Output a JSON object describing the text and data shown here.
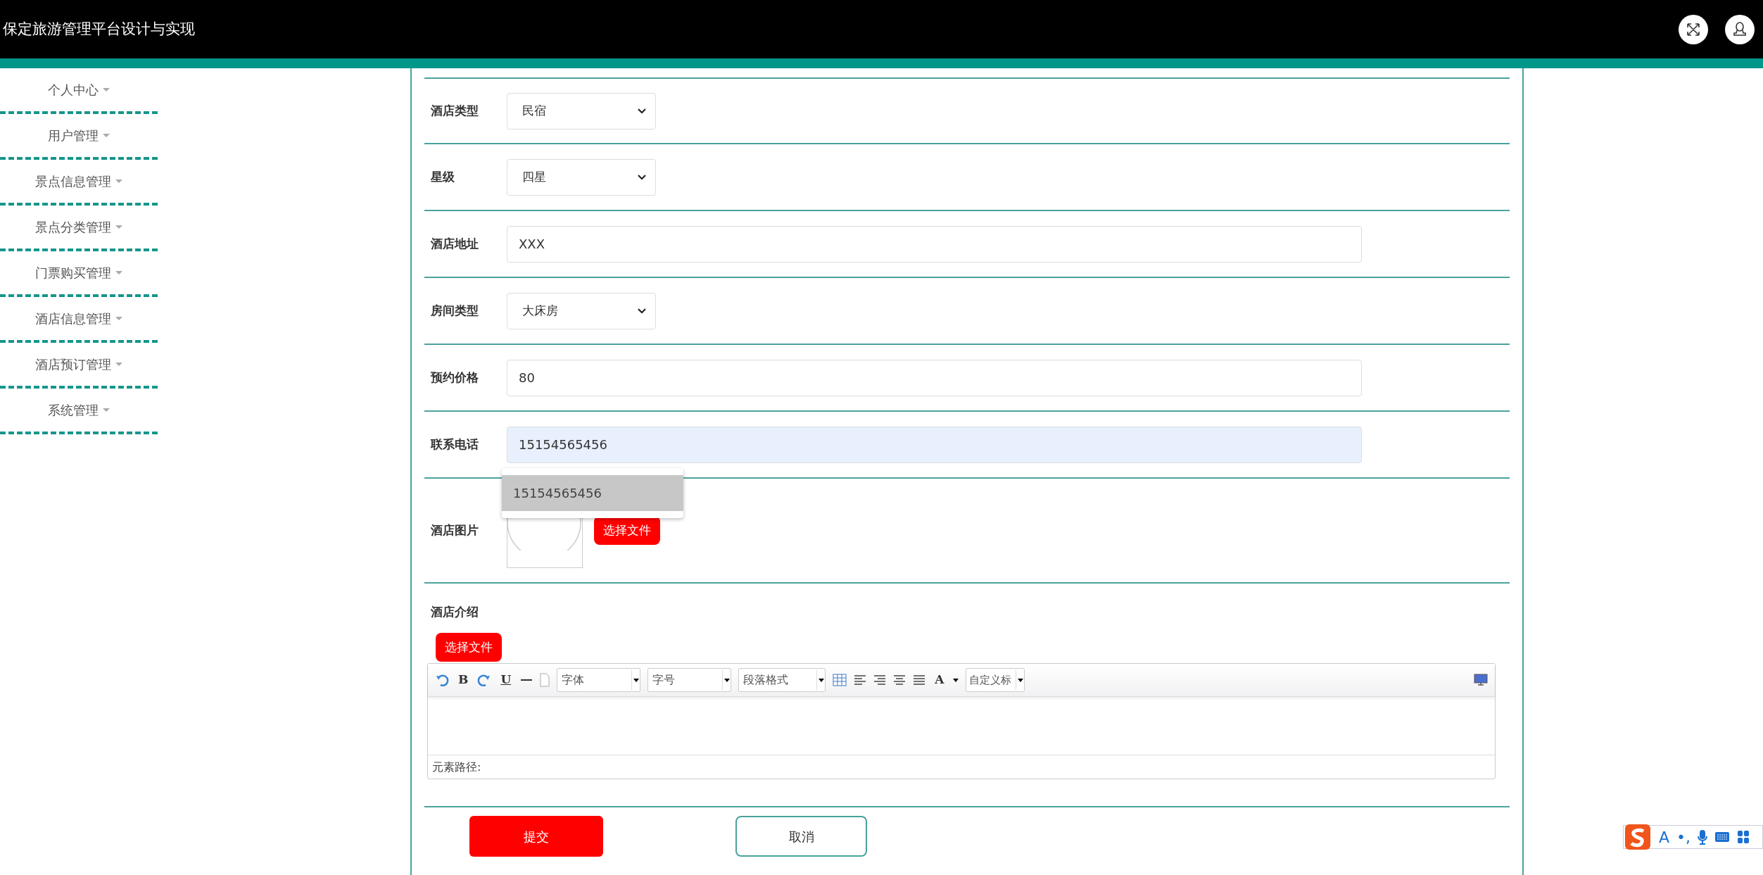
{
  "header": {
    "title": "保定旅游管理平台设计与实现"
  },
  "sidebar": {
    "items": [
      {
        "label": "个人中心"
      },
      {
        "label": "用户管理"
      },
      {
        "label": "景点信息管理"
      },
      {
        "label": "景点分类管理"
      },
      {
        "label": "门票购买管理"
      },
      {
        "label": "酒店信息管理"
      },
      {
        "label": "酒店预订管理"
      },
      {
        "label": "系统管理"
      }
    ]
  },
  "form": {
    "fields": [
      {
        "kind": "select",
        "label": "酒店类型",
        "value": "民宿"
      },
      {
        "kind": "select",
        "label": "星级",
        "value": "四星"
      },
      {
        "kind": "text",
        "label": "酒店地址",
        "value": "XXX",
        "focused": false
      },
      {
        "kind": "select",
        "label": "房间类型",
        "value": "大床房"
      },
      {
        "kind": "text",
        "label": "预约价格",
        "value": "80",
        "focused": false
      },
      {
        "kind": "text",
        "label": "联系电话",
        "value": "15154565456",
        "focused": true,
        "suggestions": [
          {
            "text": "15154565456",
            "selected": true
          }
        ]
      },
      {
        "kind": "image",
        "label": "酒店图片",
        "button": "选择文件"
      },
      {
        "kind": "editor",
        "label": "酒店介绍",
        "button": "选择文件",
        "toolbar": {
          "bold": "B",
          "underline": "U",
          "font_color": "A",
          "dropdowns": [
            "字体",
            "字号",
            "段落格式",
            "自定义标"
          ]
        },
        "path_label": "元素路径:"
      }
    ],
    "buttons": [
      {
        "label": "提交",
        "kind": "primary"
      },
      {
        "label": "取消",
        "kind": "secondary"
      }
    ]
  },
  "ime_toolbar": {
    "mode": "A",
    "punctuation": "•,"
  }
}
